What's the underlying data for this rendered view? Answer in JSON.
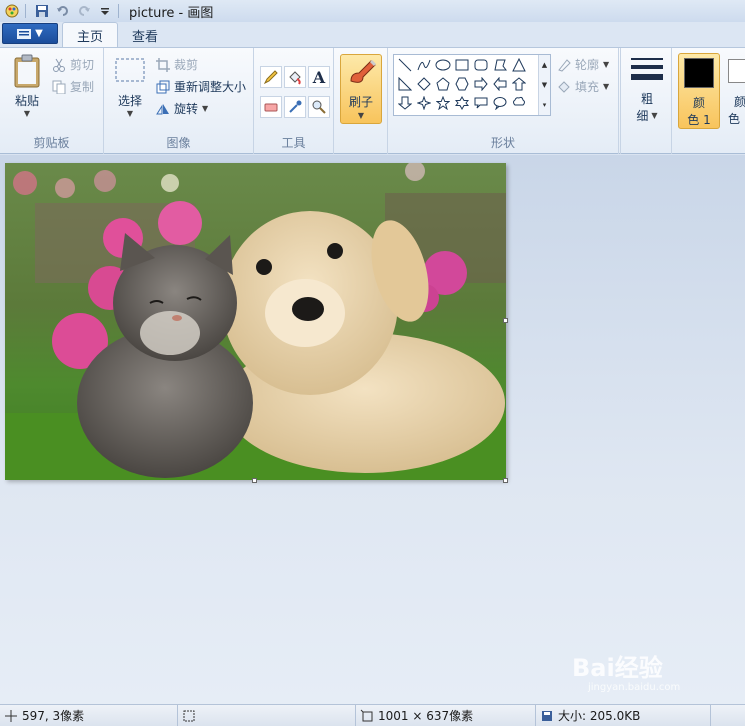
{
  "window": {
    "title": "picture - 画图"
  },
  "tabs": [
    {
      "label": "主页"
    },
    {
      "label": "查看"
    }
  ],
  "clipboard": {
    "paste_label": "粘贴",
    "cut_label": "剪切",
    "copy_label": "复制",
    "group_label": "剪贴板"
  },
  "image": {
    "select_label": "选择",
    "crop_label": "裁剪",
    "resize_label": "重新调整大小",
    "rotate_label": "旋转",
    "group_label": "图像"
  },
  "tools": {
    "group_label": "工具"
  },
  "brush": {
    "label": "刷子"
  },
  "shapes": {
    "outline_label": "轮廓",
    "fill_label": "填充",
    "group_label": "形状"
  },
  "size": {
    "label_line1": "粗",
    "label_line2": "细"
  },
  "colors": {
    "color1_line1": "颜",
    "color1_line2": "色 1",
    "color2_line1": "颜",
    "color2_line2": "色",
    "color1_value": "#000000",
    "color2_value": "#ffffff"
  },
  "status": {
    "cursor_position": "597, 3像素",
    "image_dimensions": "1001 × 637像素",
    "file_size": "大小: 205.0KB"
  },
  "watermark": {
    "text": "Bai经验",
    "sub": "jingyan.baidu.com"
  }
}
